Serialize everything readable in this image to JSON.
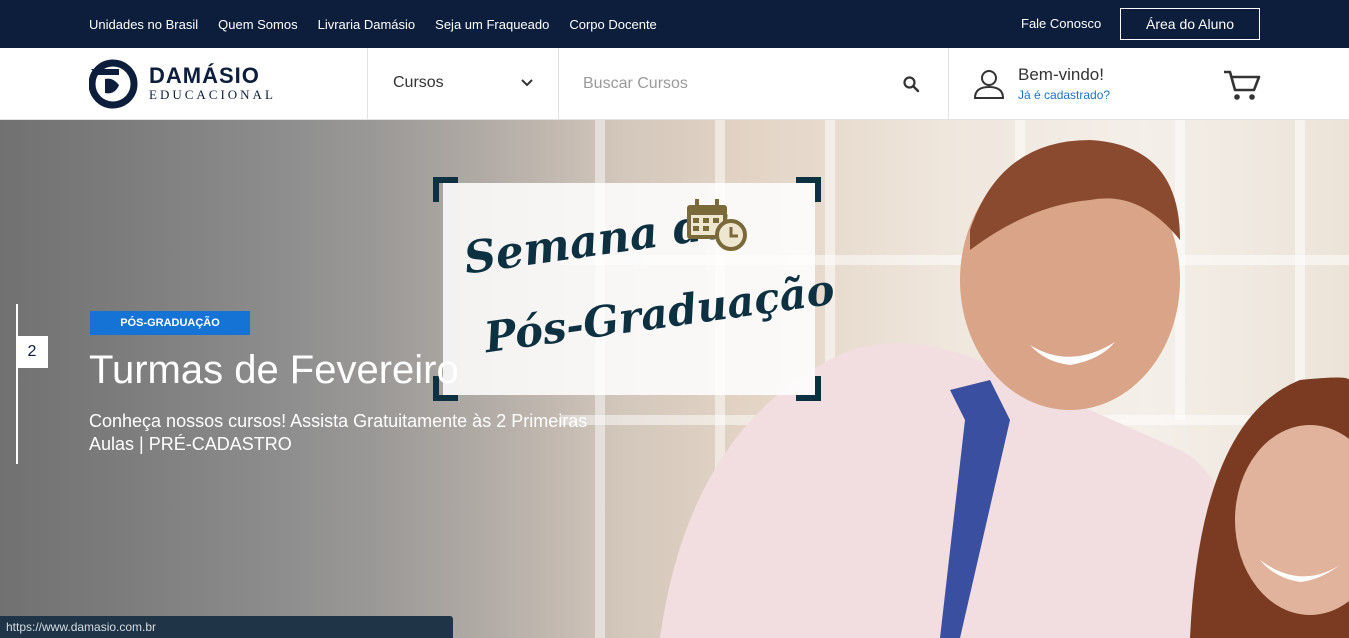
{
  "topbar": {
    "links": [
      "Unidades no Brasil",
      "Quem Somos",
      "Livraria Damásio",
      "Seja um Fraqueado",
      "Corpo Docente"
    ],
    "contact": "Fale Conosco",
    "student_area": "Área do Aluno"
  },
  "header": {
    "logo_line1": "DAMÁSIO",
    "logo_line2": "EDUCACIONAL",
    "courses_label": "Cursos",
    "search_placeholder": "Buscar Cursos",
    "welcome": "Bem-vindo!",
    "register_link": "Já é cadastrado?"
  },
  "hero": {
    "slide_number": "2",
    "tag": "PÓS-GRADUAÇÃO",
    "title": "Turmas de Fevereiro",
    "subtitle": "Conheça nossos cursos! Assista Gratuitamente às 2 Primeiras Aulas | PRÉ-CADASTRO",
    "sign_line1": "Semana da",
    "sign_line2": "Pós-Graduação"
  },
  "status_bar": {
    "url": "https://www.damasio.com.br"
  },
  "colors": {
    "navy": "#0c1e3c",
    "accent_blue": "#1673d6",
    "link_blue": "#1a73c8"
  }
}
